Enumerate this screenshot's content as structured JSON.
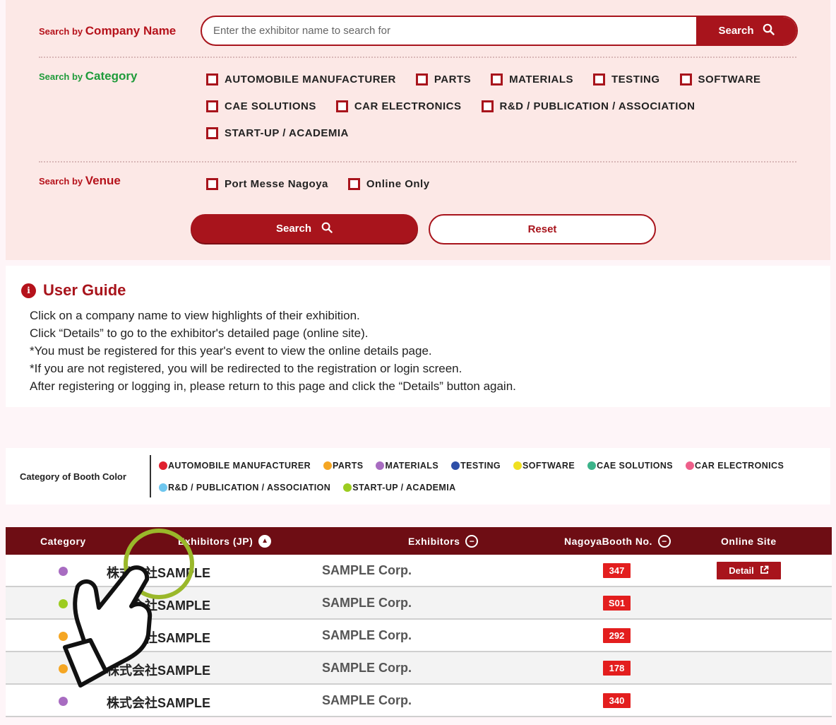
{
  "search": {
    "company_label_small": "Search by",
    "company_label_big": "Company Name",
    "placeholder": "Enter the exhibitor name to search for",
    "search_inline_label": "Search",
    "category_label_small": "Search by",
    "category_label_big": "Category",
    "categories_row1": [
      "AUTOMOBILE MANUFACTURER",
      "PARTS",
      "MATERIALS",
      "TESTING",
      "SOFTWARE"
    ],
    "categories_row2": [
      "CAE SOLUTIONS",
      "CAR ELECTRONICS",
      "R&D / PUBLICATION / ASSOCIATION"
    ],
    "categories_row3": [
      "START-UP / ACADEMIA"
    ],
    "venue_label_small": "Search by",
    "venue_label_big": "Venue",
    "venues": [
      "Port Messe Nagoya",
      "Online Only"
    ],
    "search_button": "Search",
    "reset_button": "Reset"
  },
  "guide": {
    "title": "User Guide",
    "info_glyph": "i",
    "lines": [
      "Click on a company name to view highlights of their exhibition.",
      "Click “Details” to go to the exhibitor's detailed page (online site).",
      "*You must be registered for this year's event to view the online details page.",
      "*If you are not registered, you will be redirected to the registration or login screen.",
      "After registering or logging in, please return to this page and click the “Details” button again."
    ]
  },
  "legend": {
    "title": "Category of Booth Color",
    "row1": [
      {
        "label": "AUTOMOBILE MANUFACTURER",
        "color": "#e0202e"
      },
      {
        "label": "PARTS",
        "color": "#f5a623"
      },
      {
        "label": "MATERIALS",
        "color": "#a86cc1"
      },
      {
        "label": "TESTING",
        "color": "#2e4fa8"
      },
      {
        "label": "SOFTWARE",
        "color": "#f0e020"
      },
      {
        "label": "CAE SOLUTIONS",
        "color": "#3cb38a"
      },
      {
        "label": "CAR ELECTRONICS",
        "color": "#ee5f8a"
      }
    ],
    "row2": [
      {
        "label": "R&D / PUBLICATION / ASSOCIATION",
        "color": "#6ec6ee"
      },
      {
        "label": "START-UP / ACADEMIA",
        "color": "#9ccc20"
      }
    ]
  },
  "table": {
    "headers": {
      "category": "Category",
      "exhibitors_jp": "Exhibitors (JP)",
      "exhibitors": "Exhibitors",
      "booth": "NagoyaBooth No.",
      "online": "Online Site"
    },
    "rows": [
      {
        "color": "#a86cc1",
        "jp": "株式会社SAMPLE",
        "en": "SAMPLE Corp.",
        "booth": "347",
        "detail": "Detail"
      },
      {
        "color": "#9ccc20",
        "jp": "株式会社SAMPLE",
        "en": "SAMPLE Corp.",
        "booth": "S01",
        "detail": ""
      },
      {
        "color": "#f5a623",
        "jp": "株式会社SAMPLE",
        "en": "SAMPLE Corp.",
        "booth": "292",
        "detail": ""
      },
      {
        "color": "#f5a623",
        "jp": "株式会社SAMPLE",
        "en": "SAMPLE Corp.",
        "booth": "178",
        "detail": ""
      },
      {
        "color": "#a86cc1",
        "jp": "株式会社SAMPLE",
        "en": "SAMPLE Corp.",
        "booth": "340",
        "detail": ""
      }
    ]
  },
  "colors": {
    "brand_red": "#a8141c",
    "header_bg": "#6e0d14",
    "booth_red": "#e31e1e",
    "category_green": "#1e9b3a",
    "highlight_ring": "#9ab82a"
  }
}
